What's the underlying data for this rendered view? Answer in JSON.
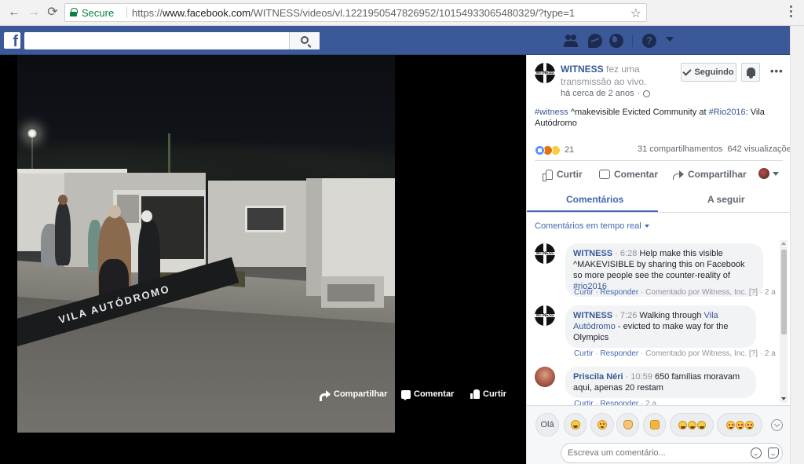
{
  "browser": {
    "secure_label": "Secure",
    "url_scheme": "https://",
    "url_host": "www.facebook.com",
    "url_path": "/WITNESS/videos/vl.1221950547826952/10154933065480329/?type=1",
    "back_glyph": "←",
    "forward_glyph": "→",
    "reload_glyph": "⟳",
    "star_glyph": "☆"
  },
  "fb": {
    "logo": "f",
    "search_placeholder": "",
    "help_glyph": "?"
  },
  "video": {
    "banner_text": "VILA AUTÓDROMO",
    "actions": {
      "share": "Compartilhar",
      "comment": "Comentar",
      "like": "Curtir"
    }
  },
  "post": {
    "page_name": "WITNESS",
    "header_suffix": " fez uma transmissão ao vivo.",
    "time": "há cerca de 2 anos",
    "meta_separator": "·",
    "follow_label": "Seguindo",
    "more_glyph": "•••",
    "avatar_text": "WITNESS",
    "text": {
      "hashtag1": "#witness",
      "part1": " ^makevisible Evicted Community at ",
      "hashtag2": "#Rio2016",
      "part2": ": Vila Autódromo"
    },
    "reactions_count": "21",
    "shares": "31 compartilhamentos",
    "views": "642 visualizações",
    "actions": {
      "like": "Curtir",
      "comment": "Comentar",
      "share": "Compartilhar"
    },
    "tabs": {
      "comments": "Comentários",
      "following": "A seguir"
    },
    "live_filter": "Comentários em tempo real"
  },
  "comments": [
    {
      "name": "WITNESS",
      "time": "6:28",
      "text_before": "Help make this visible ^MAKEVISIBLE by sharing this on Facebook so more people see the counter-reality of ",
      "link": "#rio2016",
      "text_after": "",
      "like": "Curtir",
      "reply": "Responder",
      "by": "Comentado por Witness, Inc.",
      "flag": "[?]",
      "age": "2 a"
    },
    {
      "name": "WITNESS",
      "time": "7:26",
      "text_before": "Walking through ",
      "link": "Vila Autódromo",
      "text_after": " - evicted to make way for the Olympics",
      "like": "Curtir",
      "reply": "Responder",
      "by": "Comentado por Witness, Inc.",
      "flag": "[?]",
      "age": "2 a"
    },
    {
      "name": "Priscila Néri",
      "time": "10:59",
      "text_before": "650 famílias moravam aqui, apenas 20 restam",
      "link": "",
      "text_after": "",
      "like": "Curtir",
      "reply": "Responder",
      "by": "",
      "flag": "",
      "age": "2 a"
    }
  ],
  "quick_replies": {
    "ola": "Olá"
  },
  "comment_input_placeholder": "Escreva um comentário...",
  "sep": " · "
}
